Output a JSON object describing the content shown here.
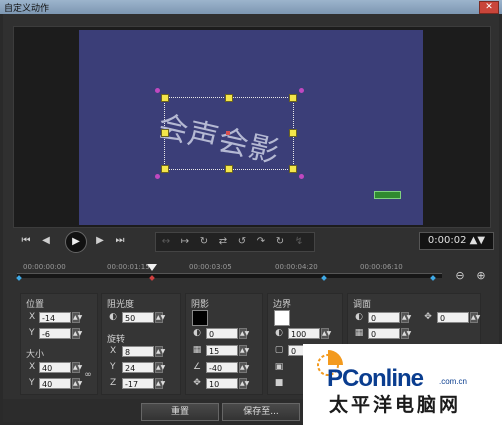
{
  "window": {
    "title": "自定义动作",
    "close_glyph": "✕"
  },
  "preview": {
    "caption": "会声会影"
  },
  "playback": {
    "home": "⏮",
    "prev": "◀",
    "play": "▶",
    "next": "▶",
    "end": "⏭",
    "timecode": "0:00:02",
    "timecode_spin": "▲▼"
  },
  "fx_icons": [
    "↔",
    "↦",
    "↻",
    "⇄",
    "↺",
    "↷",
    "↻",
    "↯"
  ],
  "ruler": {
    "ticks": [
      "00:00:00:00",
      "00:00:01:15",
      "00:00:03:05",
      "00:00:04:20",
      "00:00:06:10"
    ]
  },
  "zoom": {
    "out": "⊖",
    "in": "⊕"
  },
  "position": {
    "title": "位置",
    "x_label": "X",
    "x_value": "-14",
    "y_label": "Y",
    "y_value": "-6"
  },
  "size": {
    "title": "大小",
    "x_label": "X",
    "x_value": "40",
    "y_label": "Y",
    "y_value": "40",
    "link_icon": "∞"
  },
  "opacity": {
    "title": "阻光度",
    "value": "50"
  },
  "rotation": {
    "title": "旋转",
    "x_label": "X",
    "x_value": "8",
    "y_label": "Y",
    "y_value": "24",
    "z_label": "Z",
    "z_value": "-17"
  },
  "shadow": {
    "title": "阴影",
    "color": "#000000",
    "v1": "0",
    "v2": "15",
    "v3": "-40",
    "v4": "10"
  },
  "border": {
    "title": "边界",
    "color": "#ffffff",
    "v1": "100",
    "v2": "0"
  },
  "blur": {
    "title": "调面",
    "v1": "0",
    "v2": "0",
    "v3": "0"
  },
  "buttons": {
    "reset": "重置",
    "save_as": "保存至..."
  },
  "watermark": {
    "brand": "PConline",
    "domain": ".com.cn",
    "cn": "太平洋电脑网"
  },
  "colors": {
    "canvas": "#3b3e78",
    "handle": "#f4e64a",
    "keyframe": "#3ea9e6"
  }
}
